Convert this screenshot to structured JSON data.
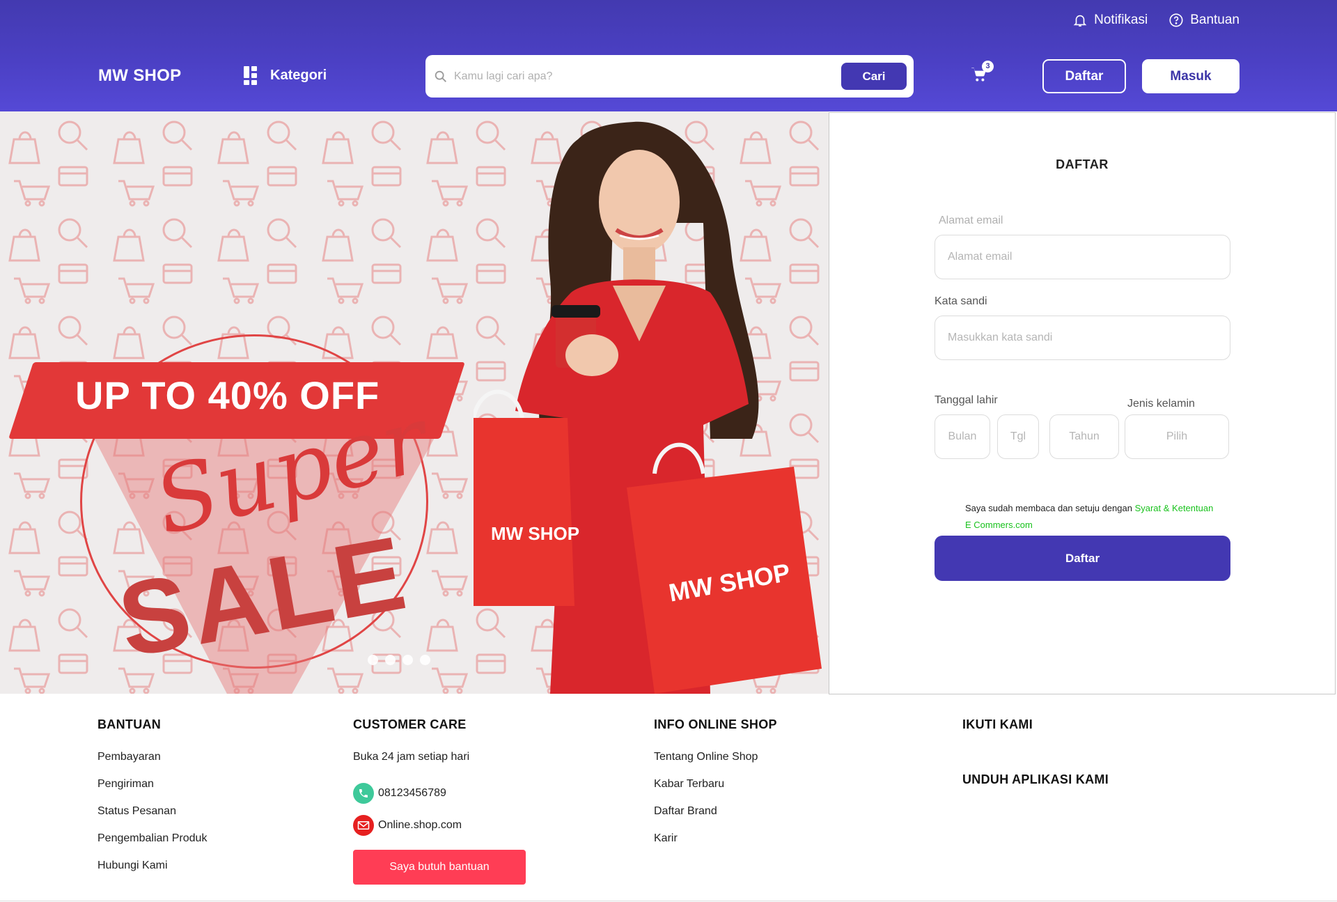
{
  "topbar": {
    "notifications": "Notifikasi",
    "help": "Bantuan"
  },
  "header": {
    "logo": "MW SHOP",
    "category": "Kategori",
    "search_placeholder": "Kamu lagi cari apa?",
    "search_button": "Cari",
    "cart_count": "3",
    "register": "Daftar",
    "login": "Masuk"
  },
  "hero": {
    "headline": "UP TO 40% OFF",
    "script_word": "Super",
    "sale_word": "SALE",
    "bag_brand": "MW SHOP",
    "slide_count": 4
  },
  "register_form": {
    "title": "DAFTAR",
    "email_label": "Alamat email",
    "email_placeholder": "Alamat email",
    "password_label": "Kata sandi",
    "password_placeholder": "Masukkan kata sandi",
    "dob_label": "Tanggal lahir",
    "month_placeholder": "Bulan",
    "day_placeholder": "Tgl",
    "year_placeholder": "Tahun",
    "gender_label": "Jenis kelamin",
    "gender_placeholder": "Pilih",
    "terms_text": "Saya sudah membaca dan setuju dengan",
    "terms_link": "Syarat & Ketentuan",
    "terms_site": "E Commers.com",
    "submit": "Daftar"
  },
  "footer": {
    "help": {
      "title": "BANTUAN",
      "links": [
        "Pembayaran",
        "Pengiriman",
        "Status Pesanan",
        "Pengembalian Produk",
        "Hubungi Kami"
      ]
    },
    "customer_care": {
      "title": "CUSTOMER CARE",
      "hours": "Buka 24 jam setiap hari",
      "phone": "08123456789",
      "email": "Online.shop.com",
      "help_button": "Saya butuh bantuan"
    },
    "info": {
      "title": "INFO ONLINE SHOP",
      "links": [
        "Tentang Online Shop",
        "Kabar Terbaru",
        "Daftar Brand",
        "Karir"
      ]
    },
    "follow": {
      "title": "IKUTI KAMI"
    },
    "download": {
      "title": "UNDUH APLIKASI KAMI"
    }
  },
  "colors": {
    "brand": "#4338b2",
    "header_gradient_top": "#433ab0",
    "header_gradient_bottom": "#5549d6",
    "accent_red": "#ff3d55",
    "terms_link": "#19c21d"
  }
}
